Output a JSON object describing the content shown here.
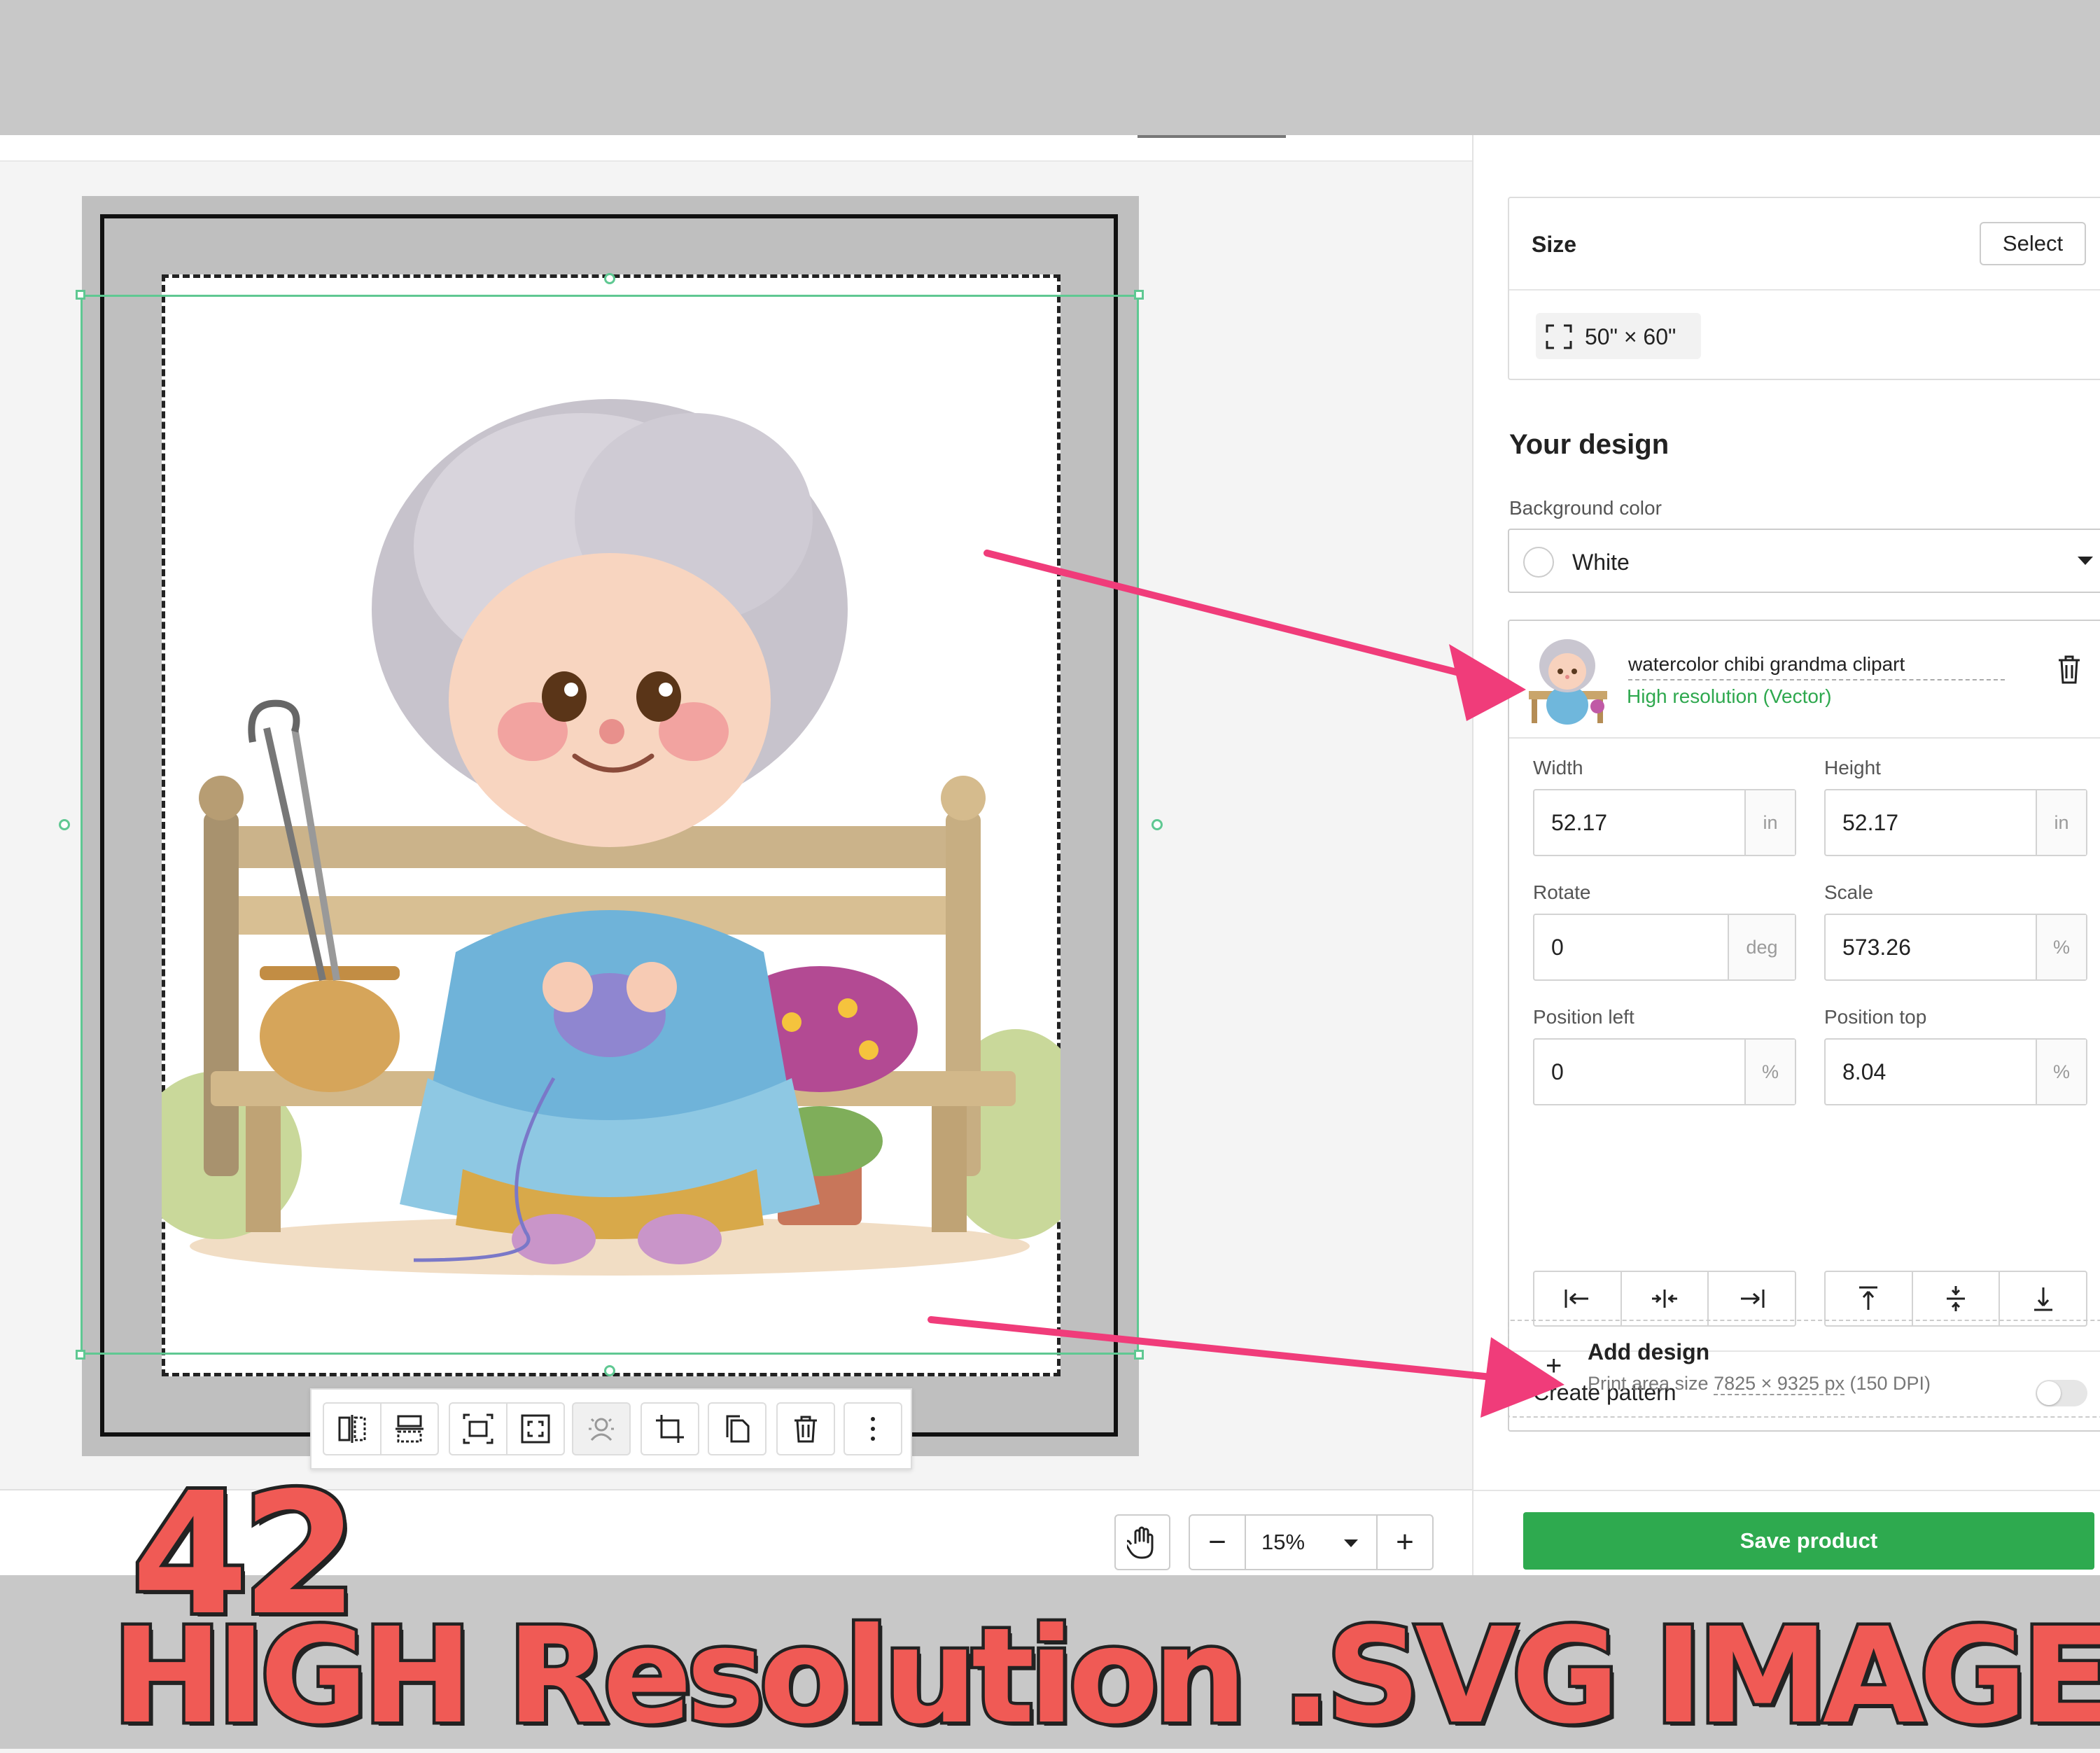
{
  "canvas": {
    "design_name": "watercolor chibi grandma clipart"
  },
  "toolbar": {
    "items": [
      "flip-horizontal",
      "flip-vertical",
      "fit-to-print-area",
      "fill-print-area",
      "remove-background",
      "crop",
      "duplicate",
      "delete",
      "more"
    ]
  },
  "zoom": {
    "value": "15%"
  },
  "panel": {
    "size": {
      "title": "Size",
      "select_label": "Select",
      "value": "50\" × 60\""
    },
    "your_design": {
      "heading": "Your design",
      "background_label": "Background color",
      "background_value": "White",
      "background_swatch": "#ffffff"
    },
    "layer": {
      "name": "watercolor chibi grandma clipart",
      "quality": "High resolution (Vector)",
      "quality_color": "#2ea84e"
    },
    "fields": {
      "width_label": "Width",
      "width_value": "52.17",
      "width_unit": "in",
      "height_label": "Height",
      "height_value": "52.17",
      "height_unit": "in",
      "rotate_label": "Rotate",
      "rotate_value": "0",
      "rotate_unit": "deg",
      "scale_label": "Scale",
      "scale_value": "573.26",
      "scale_unit": "%",
      "left_label": "Position left",
      "left_value": "0",
      "left_unit": "%",
      "top_label": "Position top",
      "top_value": "8.04",
      "top_unit": "%"
    },
    "pattern": {
      "label": "Create pattern",
      "enabled": false
    },
    "add_design": {
      "title": "Add design",
      "prefix": "Print area size ",
      "size": "7825 × 9325 px",
      "suffix": " (150 DPI)"
    },
    "save_label": "Save product",
    "save_color": "#2eaa4f"
  },
  "banner": {
    "number": "42",
    "text": "HIGH Resolution .SVG IMAGES",
    "text_color": "#f05a55"
  },
  "colors": {
    "annotation_arrow": "#f03c7a",
    "selection": "#5fc892"
  }
}
